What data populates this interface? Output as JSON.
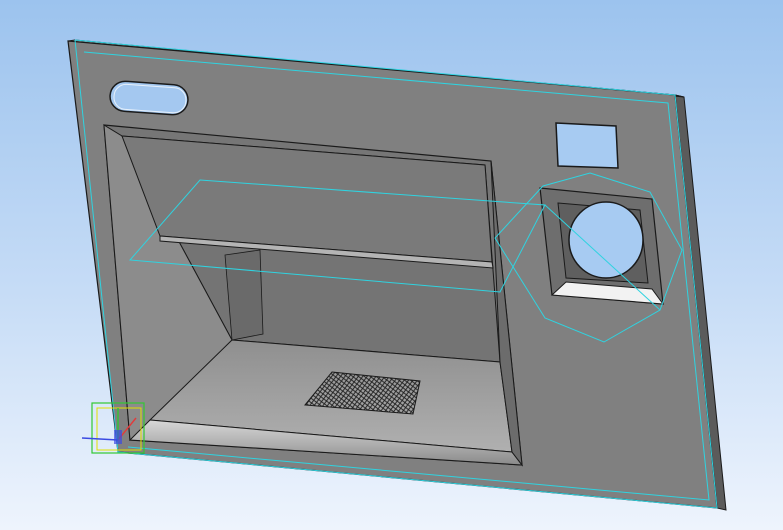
{
  "viewport": {
    "view": "3d-model-viewport",
    "background": {
      "top": "#9cc3ee",
      "bottom": "#eef4fd"
    }
  },
  "model": {
    "part": "front-panel",
    "colors": {
      "face": "#808080",
      "face_dark": "#6e6e6e",
      "edge_side": "#5b5b5b",
      "recess_wall_left": "#8c8c8c",
      "recess_back": "#747474",
      "recess_floor": "#9a9a9a",
      "shelf": "#7a7a7a",
      "outline": "#1a1a1a",
      "wireframe": "#2fd3e0",
      "mesh": "#1c1c1c"
    },
    "features": [
      "panel-face",
      "slot-hole",
      "square-window",
      "main-recess",
      "shelf",
      "mesh-grille",
      "speaker-pocket",
      "round-opening",
      "edge-highlight"
    ]
  },
  "overlay": {
    "wireframe_color": "#2fd3e0",
    "triad_axes": [
      {
        "axis": "x",
        "color": "#e23a3a"
      },
      {
        "axis": "y",
        "color": "#32c832"
      },
      {
        "axis": "z",
        "color": "#3a4ae2"
      }
    ]
  }
}
